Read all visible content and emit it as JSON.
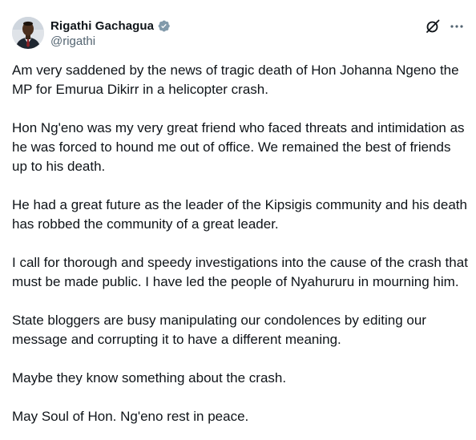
{
  "author": {
    "display_name": "Rigathi Gachagua",
    "handle": "@rigathi",
    "verified_badge_color": "#829aab",
    "avatar_icon": "profile-photo"
  },
  "header_actions": {
    "grok_icon": "grok-icon",
    "more_icon": "more-options-icon"
  },
  "tweet": {
    "paragraphs": [
      "Am very saddened by the news of tragic death of Hon Johanna Ngeno the MP for Emurua Dikirr in a helicopter crash.",
      "Hon Ng'eno was my very great friend who faced threats and intimidation as he was forced to hound me out of office. We remained the best of friends up to his death.",
      "He had a great future as the leader of the Kipsigis community and his death has robbed the community of a great leader.",
      "I call for thorough and speedy investigations into the cause of the crash that must be made public. I have led the people of Nyahururu in mourning him.",
      "State bloggers are busy manipulating our condolences by editing our message and corrupting it to have a different meaning.",
      "Maybe they know something about the crash.",
      "May Soul of Hon. Ng'eno rest in peace."
    ]
  },
  "colors": {
    "text_primary": "#0f1419",
    "text_secondary": "#536471",
    "background": "#ffffff"
  }
}
